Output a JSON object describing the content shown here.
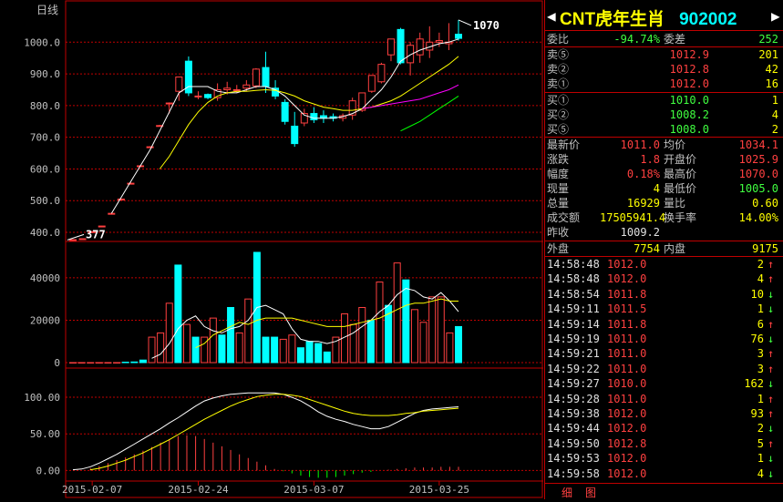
{
  "chart_data": [
    {
      "type": "candlestick",
      "period_label": "日线",
      "y_ticks": [
        "1000.0",
        "900.0",
        "800.0",
        "700.0",
        "600.0",
        "500.0",
        "400.0"
      ],
      "ylim": [
        380,
        1110
      ],
      "high_label": "1070",
      "low_label": "377",
      "x_ticks": [
        "2015-02-07",
        "2015-02-24",
        "2015-03-07",
        "2015-03-25"
      ],
      "candles": [
        {
          "o": 377,
          "h": 378,
          "l": 376,
          "c": 377
        },
        {
          "o": 378,
          "h": 380,
          "l": 377,
          "c": 380
        },
        {
          "o": 400,
          "h": 405,
          "l": 398,
          "c": 402
        },
        {
          "o": 420,
          "h": 420,
          "l": 420,
          "c": 420
        },
        {
          "o": 460,
          "h": 462,
          "l": 458,
          "c": 460
        },
        {
          "o": 505,
          "h": 507,
          "l": 503,
          "c": 505
        },
        {
          "o": 555,
          "h": 557,
          "l": 553,
          "c": 555
        },
        {
          "o": 610,
          "h": 612,
          "l": 608,
          "c": 610
        },
        {
          "o": 670,
          "h": 672,
          "l": 668,
          "c": 670
        },
        {
          "o": 737,
          "h": 739,
          "l": 735,
          "c": 737
        },
        {
          "o": 808,
          "h": 810,
          "l": 775,
          "c": 808
        },
        {
          "o": 845,
          "h": 885,
          "l": 815,
          "c": 890
        },
        {
          "o": 940,
          "h": 955,
          "l": 830,
          "c": 840
        },
        {
          "o": 830,
          "h": 845,
          "l": 820,
          "c": 830
        },
        {
          "o": 835,
          "h": 838,
          "l": 820,
          "c": 825
        },
        {
          "o": 825,
          "h": 870,
          "l": 815,
          "c": 850
        },
        {
          "o": 850,
          "h": 875,
          "l": 835,
          "c": 855
        },
        {
          "o": 850,
          "h": 865,
          "l": 840,
          "c": 850
        },
        {
          "o": 855,
          "h": 880,
          "l": 845,
          "c": 865
        },
        {
          "o": 862,
          "h": 918,
          "l": 855,
          "c": 915
        },
        {
          "o": 920,
          "h": 970,
          "l": 840,
          "c": 860
        },
        {
          "o": 855,
          "h": 880,
          "l": 820,
          "c": 830
        },
        {
          "o": 810,
          "h": 820,
          "l": 740,
          "c": 750
        },
        {
          "o": 735,
          "h": 780,
          "l": 670,
          "c": 680
        },
        {
          "o": 745,
          "h": 790,
          "l": 735,
          "c": 775
        },
        {
          "o": 775,
          "h": 795,
          "l": 745,
          "c": 755
        },
        {
          "o": 768,
          "h": 785,
          "l": 745,
          "c": 760
        },
        {
          "o": 765,
          "h": 775,
          "l": 750,
          "c": 760
        },
        {
          "o": 760,
          "h": 775,
          "l": 750,
          "c": 768
        },
        {
          "o": 770,
          "h": 825,
          "l": 755,
          "c": 815
        },
        {
          "o": 785,
          "h": 840,
          "l": 780,
          "c": 840
        },
        {
          "o": 845,
          "h": 895,
          "l": 840,
          "c": 895
        },
        {
          "o": 875,
          "h": 935,
          "l": 870,
          "c": 930
        },
        {
          "o": 960,
          "h": 1010,
          "l": 940,
          "c": 1010
        },
        {
          "o": 1040,
          "h": 1045,
          "l": 930,
          "c": 935
        },
        {
          "o": 935,
          "h": 1000,
          "l": 895,
          "c": 990
        },
        {
          "o": 960,
          "h": 1030,
          "l": 935,
          "c": 1010
        },
        {
          "o": 975,
          "h": 1050,
          "l": 950,
          "c": 1000
        },
        {
          "o": 1000,
          "h": 1030,
          "l": 985,
          "c": 1005
        },
        {
          "o": 995,
          "h": 1060,
          "l": 975,
          "c": 1000
        },
        {
          "o": 1025,
          "h": 1070,
          "l": 1005,
          "c": 1012
        }
      ],
      "ma_lines": [
        {
          "name": "MA5",
          "color": "#ffffff",
          "values": [
            null,
            null,
            null,
            null,
            460,
            510,
            560,
            610,
            660,
            720,
            780,
            840,
            860,
            860,
            860,
            845,
            840,
            840,
            850,
            860,
            860,
            850,
            830,
            800,
            770,
            760,
            760,
            760,
            765,
            775,
            790,
            820,
            850,
            890,
            940,
            960,
            975,
            985,
            995,
            1000,
            1010
          ]
        },
        {
          "name": "MA10",
          "color": "#ffff00",
          "values": [
            null,
            null,
            null,
            null,
            null,
            null,
            null,
            null,
            null,
            600,
            640,
            690,
            740,
            780,
            810,
            830,
            840,
            845,
            845,
            848,
            850,
            848,
            840,
            830,
            815,
            805,
            795,
            790,
            785,
            785,
            790,
            795,
            805,
            815,
            830,
            850,
            870,
            890,
            910,
            930,
            955
          ]
        },
        {
          "name": "MA20",
          "color": "#ff00ff",
          "values": [
            null,
            null,
            null,
            null,
            null,
            null,
            null,
            null,
            null,
            null,
            null,
            null,
            null,
            null,
            null,
            null,
            null,
            null,
            null,
            null,
            null,
            null,
            null,
            null,
            null,
            null,
            null,
            null,
            null,
            null,
            790,
            795,
            800,
            805,
            810,
            815,
            820,
            830,
            840,
            850,
            865
          ]
        },
        {
          "name": "MA30",
          "color": "#00ff00",
          "values": [
            null,
            null,
            null,
            null,
            null,
            null,
            null,
            null,
            null,
            null,
            null,
            null,
            null,
            null,
            null,
            null,
            null,
            null,
            null,
            null,
            null,
            null,
            null,
            null,
            null,
            null,
            null,
            null,
            null,
            null,
            null,
            null,
            null,
            null,
            720,
            735,
            750,
            770,
            790,
            810,
            830
          ]
        }
      ]
    },
    {
      "type": "bar",
      "y_ticks": [
        "40000",
        "20000",
        "0"
      ],
      "ylim": [
        0,
        55000
      ],
      "values": [
        0,
        0,
        0,
        0,
        0,
        0,
        200,
        300,
        1200,
        12000,
        14000,
        28000,
        46000,
        18000,
        12000,
        12000,
        21000,
        13000,
        26000,
        14000,
        30000,
        52000,
        12000,
        12000,
        11000,
        13000,
        7000,
        10000,
        9000,
        5000,
        12000,
        23000,
        18000,
        26000,
        20000,
        38000,
        27000,
        47000,
        39000,
        25000,
        19000,
        31000,
        31000,
        14000,
        17000
      ],
      "up": [
        true,
        true,
        true,
        true,
        true,
        true,
        false,
        false,
        false,
        true,
        true,
        true,
        false,
        true,
        false,
        true,
        true,
        false,
        false,
        true,
        true,
        false,
        false,
        false,
        true,
        true,
        false,
        false,
        false,
        false,
        true,
        true,
        true,
        true,
        false,
        true,
        false,
        true,
        false,
        true,
        true,
        true,
        true,
        true,
        false
      ],
      "vol_ma5": [
        null,
        null,
        null,
        null,
        null,
        null,
        null,
        null,
        null,
        2000,
        4000,
        9000,
        16000,
        20000,
        22000,
        17000,
        15000,
        14000,
        16000,
        17000,
        20000,
        26000,
        27000,
        25000,
        23000,
        16000,
        11000,
        10000,
        10000,
        9000,
        10000,
        12000,
        14000,
        17000,
        20000,
        24000,
        27000,
        32000,
        35000,
        34000,
        31000,
        30000,
        33000,
        29000,
        24000
      ],
      "vol_ma10": [
        null,
        null,
        null,
        null,
        null,
        null,
        null,
        null,
        null,
        null,
        null,
        null,
        null,
        null,
        7000,
        9000,
        13000,
        15000,
        17000,
        19000,
        18000,
        20000,
        21000,
        21000,
        21000,
        21000,
        20000,
        19000,
        18000,
        17000,
        17000,
        17000,
        18000,
        19000,
        20000,
        21000,
        23000,
        25000,
        27000,
        28000,
        28000,
        29000,
        30000,
        29000,
        29000
      ]
    },
    {
      "type": "bar",
      "y_ticks": [
        "100.00",
        "50.00",
        "0.00"
      ],
      "ylim": [
        -12,
        120
      ],
      "values": [
        0,
        0,
        3,
        6,
        10,
        14,
        18,
        22,
        27,
        32,
        38,
        43,
        47,
        48,
        47,
        43,
        38,
        33,
        28,
        22,
        17,
        12,
        7,
        2,
        -1,
        -4,
        -7,
        -9,
        -10,
        -10,
        -9,
        -7,
        -5,
        -3,
        -2,
        0,
        1,
        2,
        3,
        4,
        4,
        4,
        5,
        5,
        5
      ],
      "line_white": [
        1,
        2,
        5,
        10,
        16,
        22,
        29,
        36,
        43,
        50,
        57,
        65,
        72,
        80,
        88,
        95,
        99,
        102,
        104,
        105,
        106,
        106,
        106,
        106,
        104,
        100,
        95,
        88,
        80,
        74,
        70,
        67,
        63,
        60,
        57,
        57,
        60,
        66,
        72,
        78,
        82,
        84,
        85,
        86,
        87
      ],
      "line_yellow": [
        null,
        null,
        1,
        3,
        6,
        10,
        14,
        19,
        24,
        30,
        36,
        42,
        49,
        56,
        63,
        70,
        76,
        82,
        88,
        93,
        97,
        101,
        103,
        104,
        104,
        103,
        101,
        97,
        93,
        89,
        85,
        81,
        78,
        76,
        75,
        75,
        75,
        76,
        78,
        79,
        81,
        82,
        83,
        84,
        85
      ]
    }
  ],
  "quote": {
    "title": "CNT虎年生肖",
    "code": "902002",
    "webi_label": "委比",
    "webi": "-94.74%",
    "weicha_label": "委差",
    "weicha": "252",
    "sells": [
      {
        "label": "卖⑤",
        "price": "1012.9",
        "qty": "201"
      },
      {
        "label": "卖②",
        "price": "1012.8",
        "qty": "42"
      },
      {
        "label": "卖①",
        "price": "1012.0",
        "qty": "16"
      }
    ],
    "buys": [
      {
        "label": "买①",
        "price": "1010.0",
        "qty": "1"
      },
      {
        "label": "买②",
        "price": "1008.2",
        "qty": "4"
      },
      {
        "label": "买⑤",
        "price": "1008.0",
        "qty": "2"
      }
    ],
    "stats": [
      {
        "l1": "最新价",
        "v1": "1011.0",
        "c1": "red",
        "l2": "均价",
        "v2": "1034.1",
        "c2": "red"
      },
      {
        "l1": "涨跌",
        "v1": "1.8",
        "c1": "red",
        "l2": "开盘价",
        "v2": "1025.9",
        "c2": "red"
      },
      {
        "l1": "幅度",
        "v1": "0.18%",
        "c1": "red",
        "l2": "最高价",
        "v2": "1070.0",
        "c2": "red"
      },
      {
        "l1": "现量",
        "v1": "4",
        "c1": "yellow",
        "l2": "最低价",
        "v2": "1005.0",
        "c2": "green"
      },
      {
        "l1": "总量",
        "v1": "16929",
        "c1": "yellow",
        "l2": "量比",
        "v2": "0.60",
        "c2": "yellow"
      },
      {
        "l1": "成交额",
        "v1": "17505941.4",
        "c1": "yellow",
        "l2": "换手率",
        "v2": "14.00%",
        "c2": "yellow"
      },
      {
        "l1": "昨收",
        "v1": "1009.2",
        "c1": "white",
        "l2": "",
        "v2": "",
        "c2": "white"
      }
    ],
    "waipan_label": "外盘",
    "waipan": "7754",
    "neipan_label": "内盘",
    "neipan": "9175",
    "ticks": [
      {
        "t": "14:58:48",
        "p": "1012.0",
        "q": "2",
        "d": "↑"
      },
      {
        "t": "14:58:48",
        "p": "1012.0",
        "q": "4",
        "d": "↑"
      },
      {
        "t": "14:58:54",
        "p": "1011.8",
        "q": "10",
        "d": "↓"
      },
      {
        "t": "14:59:11",
        "p": "1011.5",
        "q": "1",
        "d": "↓"
      },
      {
        "t": "14:59:14",
        "p": "1011.8",
        "q": "6",
        "d": "↑"
      },
      {
        "t": "14:59:19",
        "p": "1011.0",
        "q": "76",
        "d": "↓"
      },
      {
        "t": "14:59:21",
        "p": "1011.0",
        "q": "3",
        "d": "↑"
      },
      {
        "t": "14:59:22",
        "p": "1011.0",
        "q": "3",
        "d": "↑"
      },
      {
        "t": "14:59:27",
        "p": "1010.0",
        "q": "162",
        "d": "↓"
      },
      {
        "t": "14:59:28",
        "p": "1011.0",
        "q": "1",
        "d": "↑"
      },
      {
        "t": "14:59:38",
        "p": "1012.0",
        "q": "93",
        "d": "↑"
      },
      {
        "t": "14:59:44",
        "p": "1012.0",
        "q": "2",
        "d": "↓"
      },
      {
        "t": "14:59:50",
        "p": "1012.8",
        "q": "5",
        "d": "↑"
      },
      {
        "t": "14:59:53",
        "p": "1012.0",
        "q": "1",
        "d": "↓"
      },
      {
        "t": "14:59:58",
        "p": "1012.0",
        "q": "4",
        "d": "↓"
      }
    ],
    "tabs": [
      "细",
      "图"
    ],
    "colors": {
      "up": "#ff4040",
      "down": "#00ffff",
      "grid": "#c00000",
      "ma5": "#ffffff",
      "ma10": "#ffff00",
      "ma20": "#ff00ff",
      "ma30": "#00ff00"
    }
  }
}
